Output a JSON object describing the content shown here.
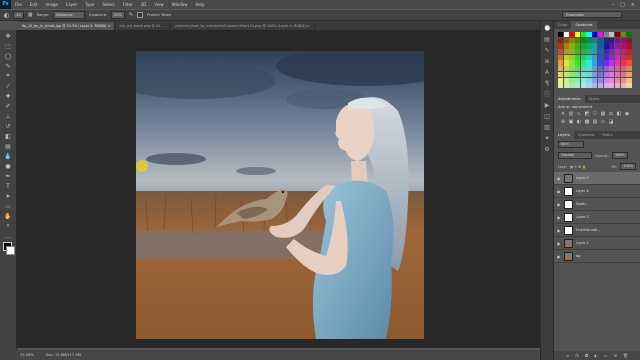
{
  "app": {
    "logo": "Ps"
  },
  "menu": [
    "File",
    "Edit",
    "Image",
    "Layer",
    "Type",
    "Select",
    "Filter",
    "3D",
    "View",
    "Window",
    "Help"
  ],
  "window_buttons": [
    "–",
    "□",
    "×"
  ],
  "options": {
    "brush_size": "20",
    "range_label": "Range:",
    "range_value": "Midtones",
    "exposure_label": "Exposure:",
    "exposure_value": "50%",
    "protect_label": "Protect Tones"
  },
  "workspace": "Essentials",
  "tabs": [
    {
      "label": "fig_10_by_jir_trinek.jpg @ 33.3% (Layer 3, RGB/8) ×",
      "active": true
    },
    {
      "label": "cut_out_stock.png @ 25 …",
      "active": false
    },
    {
      "label": "_collared_dove_by_mimmetto5-stocks d5se17d.png @ 100% (Layer 0, RGB/8) ×",
      "active": false
    }
  ],
  "status": {
    "zoom": "33.33%",
    "doc": "Doc: 15.8M/117.3M"
  },
  "swatches_panel": {
    "tab1": "Color",
    "tab2": "Swatches"
  },
  "adjustments_panel": {
    "tab1": "Adjustments",
    "tab2": "Styles",
    "title": "Add an adjustment"
  },
  "layers_panel": {
    "tab1": "Layers",
    "tab2": "Channels",
    "tab3": "Paths",
    "kind": "Kind",
    "blend": "Overlay",
    "opacity_label": "Opacity:",
    "opacity": "100%",
    "lock_label": "Lock:",
    "fill_label": "Fill:",
    "fill": "100%"
  },
  "layers": [
    {
      "name": "Layer 5",
      "selected": true,
      "thumb": "gray"
    },
    {
      "name": "Layer 4",
      "selected": false,
      "thumb": "white"
    },
    {
      "name": "Dodk…",
      "selected": false,
      "thumb": "white"
    },
    {
      "name": "Layer 2",
      "selected": false,
      "thumb": "white"
    },
    {
      "name": "Hue/Saturati…",
      "selected": false,
      "thumb": "white"
    },
    {
      "name": "Layer 1",
      "selected": false,
      "thumb": "img"
    },
    {
      "name": "bg",
      "selected": false,
      "thumb": "img"
    }
  ],
  "colors": {
    "accent": "#31a8ff",
    "ui_dark": "#282828",
    "panel": "#535353"
  }
}
